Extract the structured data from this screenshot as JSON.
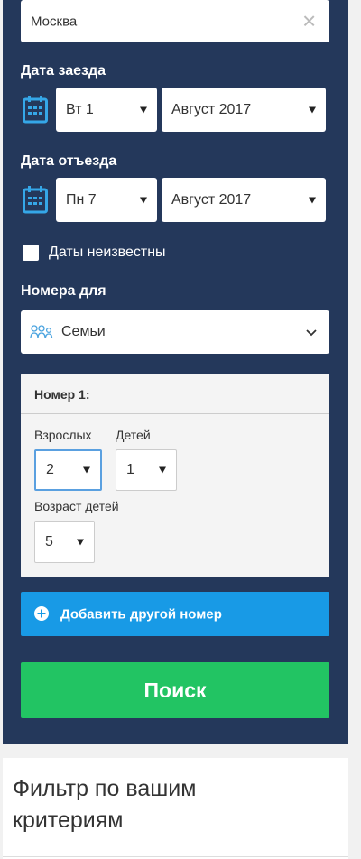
{
  "destination": {
    "value": "Москва"
  },
  "checkin": {
    "label": "Дата заезда",
    "day": "Вт 1",
    "month": "Август 2017"
  },
  "checkout": {
    "label": "Дата отъезда",
    "day": "Пн 7",
    "month": "Август 2017"
  },
  "unknown_dates": {
    "label": "Даты неизвестны",
    "checked": false
  },
  "rooms_for": {
    "label": "Номера для",
    "value": "Семьи"
  },
  "room1": {
    "title": "Номер 1:",
    "adults_label": "Взрослых",
    "adults": "2",
    "children_label": "Детей",
    "children": "1",
    "child_age_label": "Возраст детей",
    "child_age": "5"
  },
  "add_room": {
    "label": "Добавить другой номер"
  },
  "search": {
    "label": "Поиск"
  },
  "filter": {
    "title": "Фильтр по вашим критериям"
  },
  "colors": {
    "panel": "#24385b",
    "accent_blue": "#189ae6",
    "search_green": "#22c463",
    "icon_blue": "#35a7e8"
  }
}
